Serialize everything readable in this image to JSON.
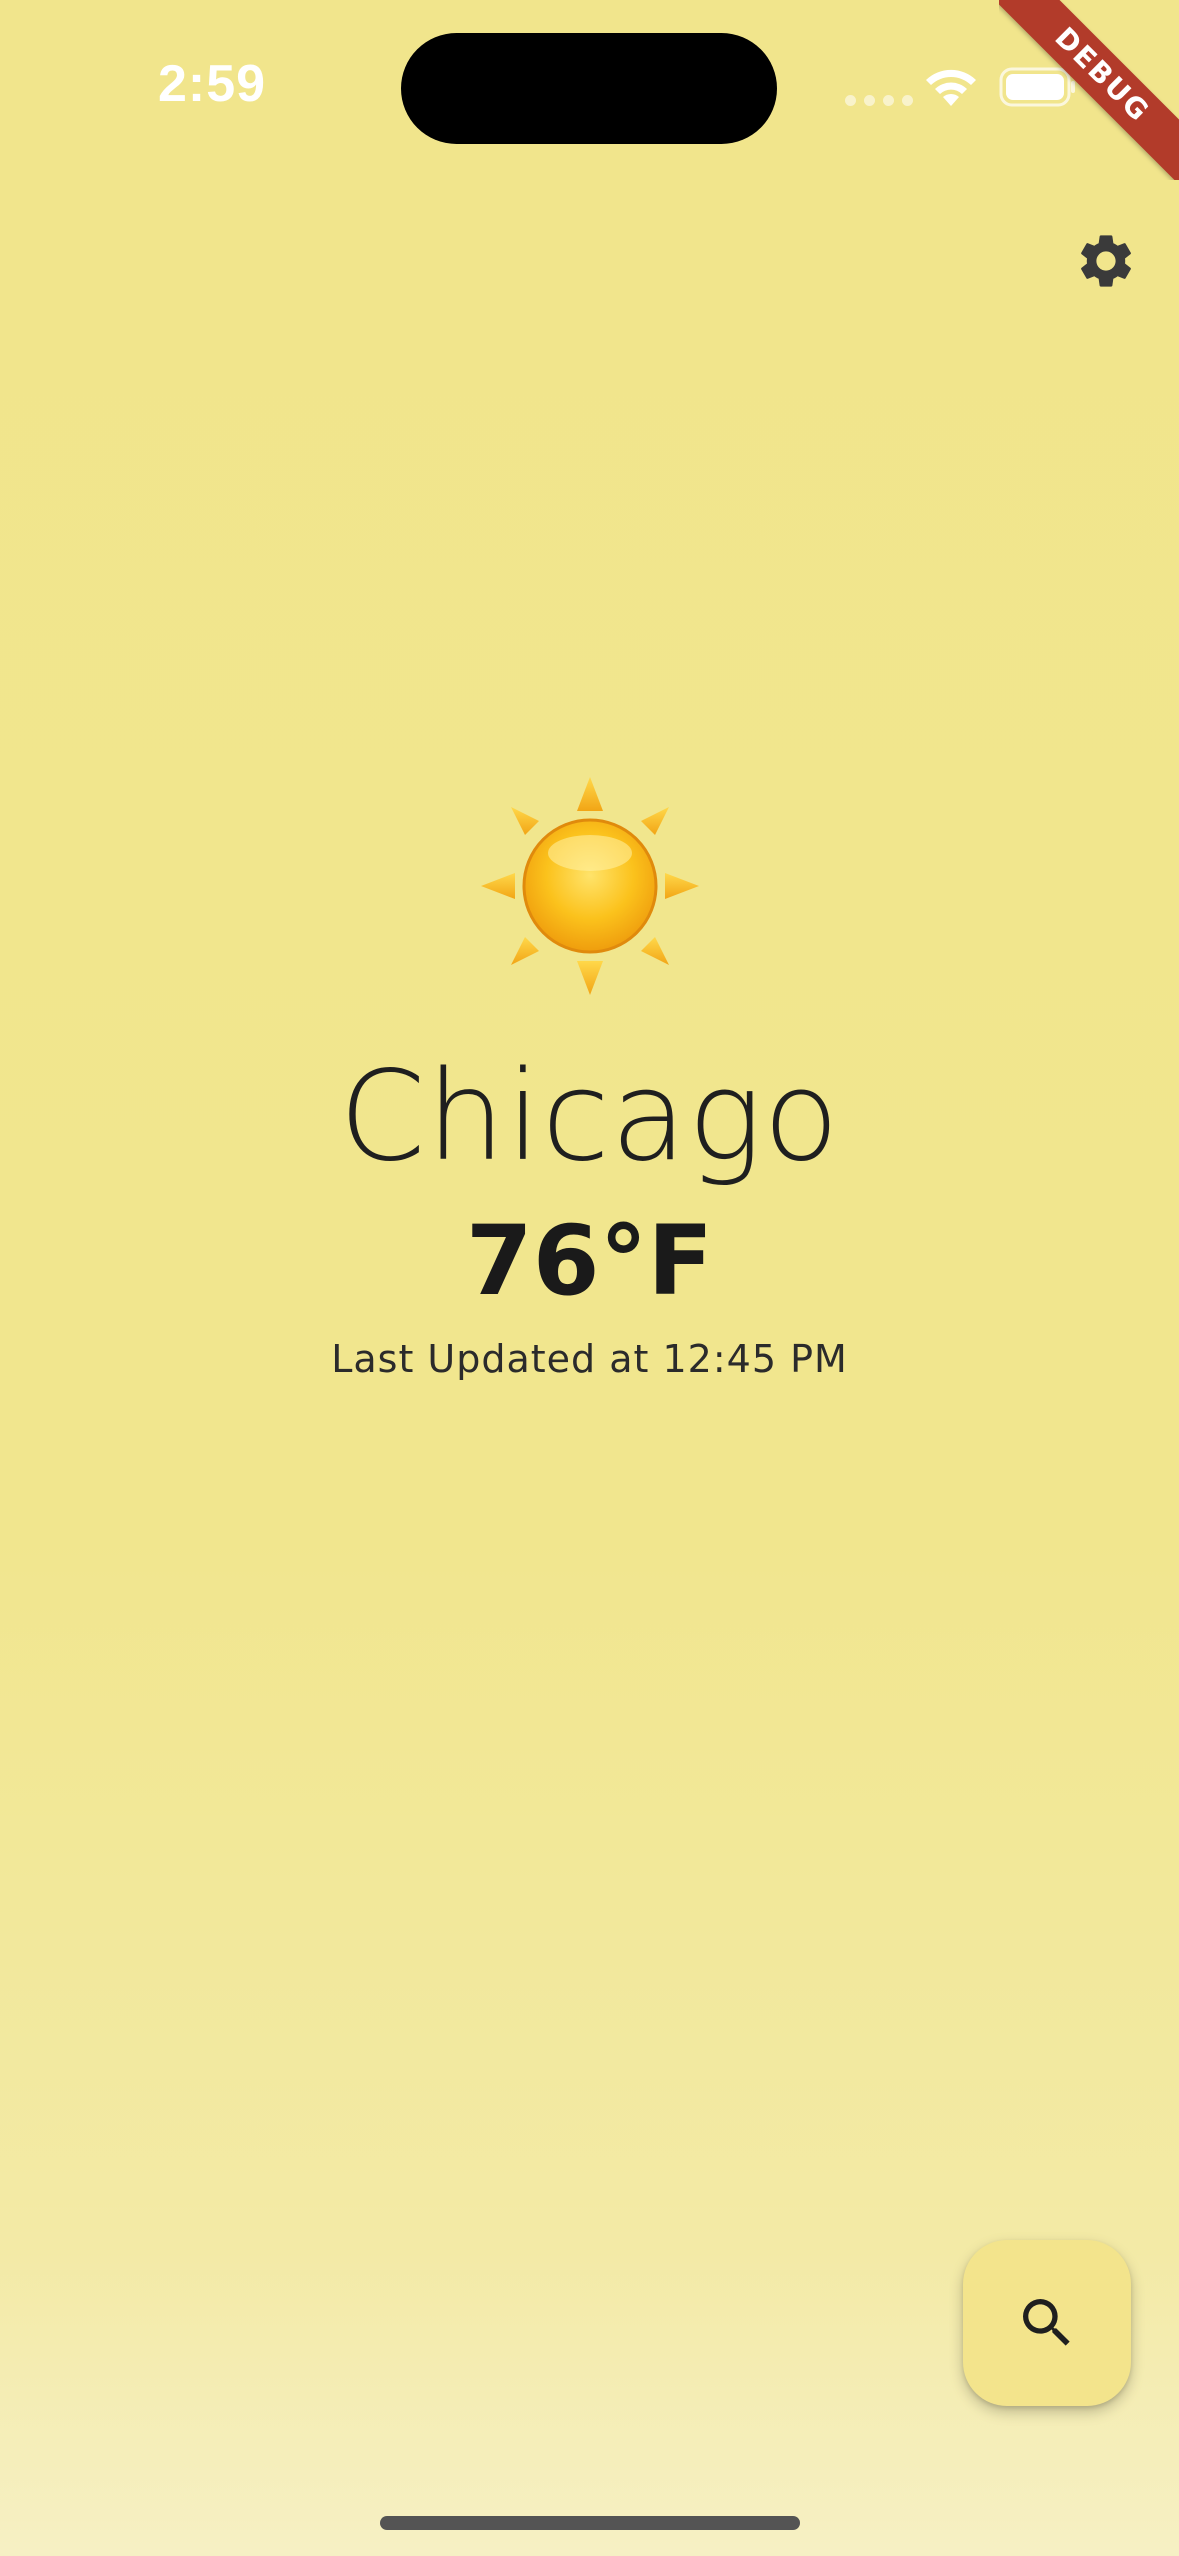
{
  "status_bar": {
    "time": "2:59",
    "icons": [
      "cellular-signal-icon",
      "wifi-icon",
      "battery-icon"
    ]
  },
  "debug_banner": {
    "label": "DEBUG"
  },
  "toolbar": {
    "settings_icon": "gear-icon"
  },
  "weather": {
    "condition_icon": "sun-icon",
    "city": "Chicago",
    "temperature": "76°F",
    "last_updated": "Last Updated at 12:45 PM"
  },
  "fab": {
    "icon": "search-icon"
  },
  "colors": {
    "background": "#f1e58c",
    "background_bottom": "#f6f0c4",
    "text": "#1f1f1f",
    "icon": "#3a3a3a",
    "fab": "#f3e48c",
    "debug_ribbon": "#b23b2a"
  }
}
